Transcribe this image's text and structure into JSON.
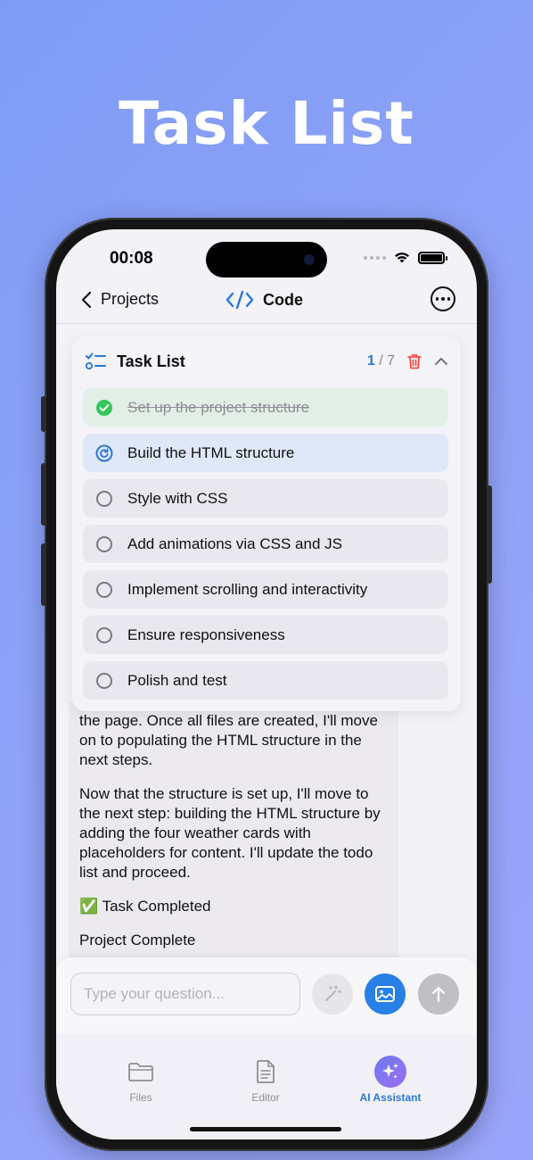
{
  "hero": {
    "title": "Task List"
  },
  "status": {
    "time": "00:08"
  },
  "nav": {
    "back_label": "Projects",
    "title": "Code"
  },
  "panel": {
    "title": "Task List",
    "counter_current": "1",
    "counter_total": "7",
    "tasks": [
      {
        "label": "Set up the project structure",
        "state": "done"
      },
      {
        "label": "Build the HTML structure",
        "state": "in-progress"
      },
      {
        "label": "Style with CSS",
        "state": "pending"
      },
      {
        "label": "Add animations via CSS and JS",
        "state": "pending"
      },
      {
        "label": "Implement scrolling and interactivity",
        "state": "pending"
      },
      {
        "label": "Ensure responsiveness",
        "state": "pending"
      },
      {
        "label": "Polish and test",
        "state": "pending"
      }
    ]
  },
  "chat": {
    "p1": "the page. Once all files are created, I'll move on to populating the HTML structure in the next steps.",
    "p2": "Now that the structure is set up, I'll move to the next step: building the HTML structure by adding the four weather cards with placeholders for content. I'll update the todo list and proceed.",
    "p3": "✅ Task Completed",
    "p4": "Project Complete"
  },
  "input": {
    "placeholder": "Type your question..."
  },
  "tabs": [
    {
      "label": "Files",
      "icon": "folder-icon"
    },
    {
      "label": "Editor",
      "icon": "document-icon"
    },
    {
      "label": "AI Assistant",
      "icon": "sparkles-icon",
      "active": true
    }
  ],
  "colors": {
    "accent": "#2a78d6",
    "done": "#34c759",
    "delete": "#ff3b30"
  }
}
